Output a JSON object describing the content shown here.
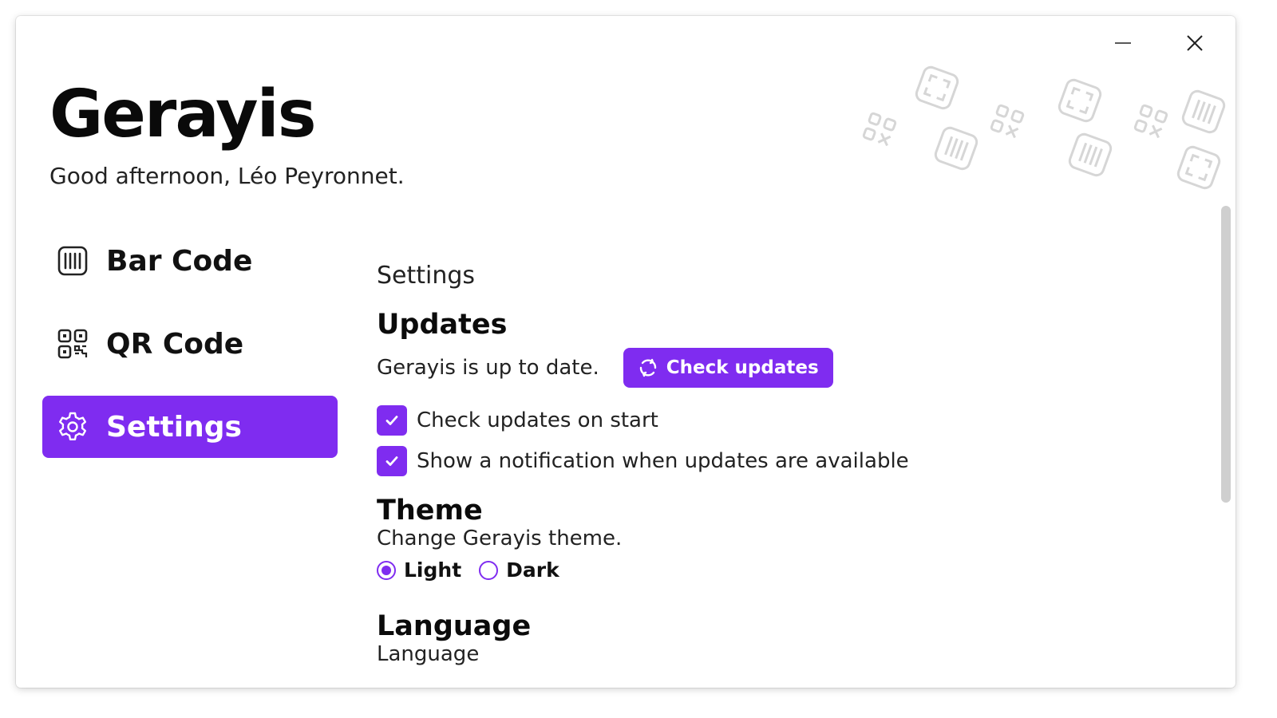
{
  "window": {
    "minimize_icon": "minimize-icon",
    "close_icon": "close-icon"
  },
  "header": {
    "title": "Gerayis",
    "greeting": "Good afternoon, Léo Peyronnet."
  },
  "nav": {
    "items": [
      {
        "label": "Bar Code",
        "icon": "barcode-icon",
        "active": false
      },
      {
        "label": "QR Code",
        "icon": "qrcode-icon",
        "active": false
      },
      {
        "label": "Settings",
        "icon": "gear-icon",
        "active": true
      }
    ]
  },
  "settings": {
    "section_title": "Settings",
    "updates": {
      "heading": "Updates",
      "status": "Gerayis is up to date.",
      "check_button_label": "Check updates",
      "check_button_icon": "refresh-icon",
      "options": [
        {
          "label": "Check updates on start",
          "checked": true
        },
        {
          "label": "Show a notification when updates are available",
          "checked": true
        }
      ]
    },
    "theme": {
      "heading": "Theme",
      "description": "Change Gerayis theme.",
      "options": [
        {
          "label": "Light",
          "selected": true
        },
        {
          "label": "Dark",
          "selected": false
        }
      ]
    },
    "language": {
      "heading": "Language",
      "description": "Language"
    }
  },
  "colors": {
    "accent": "#7f2cf0",
    "text": "#111111",
    "background": "#ffffff"
  }
}
